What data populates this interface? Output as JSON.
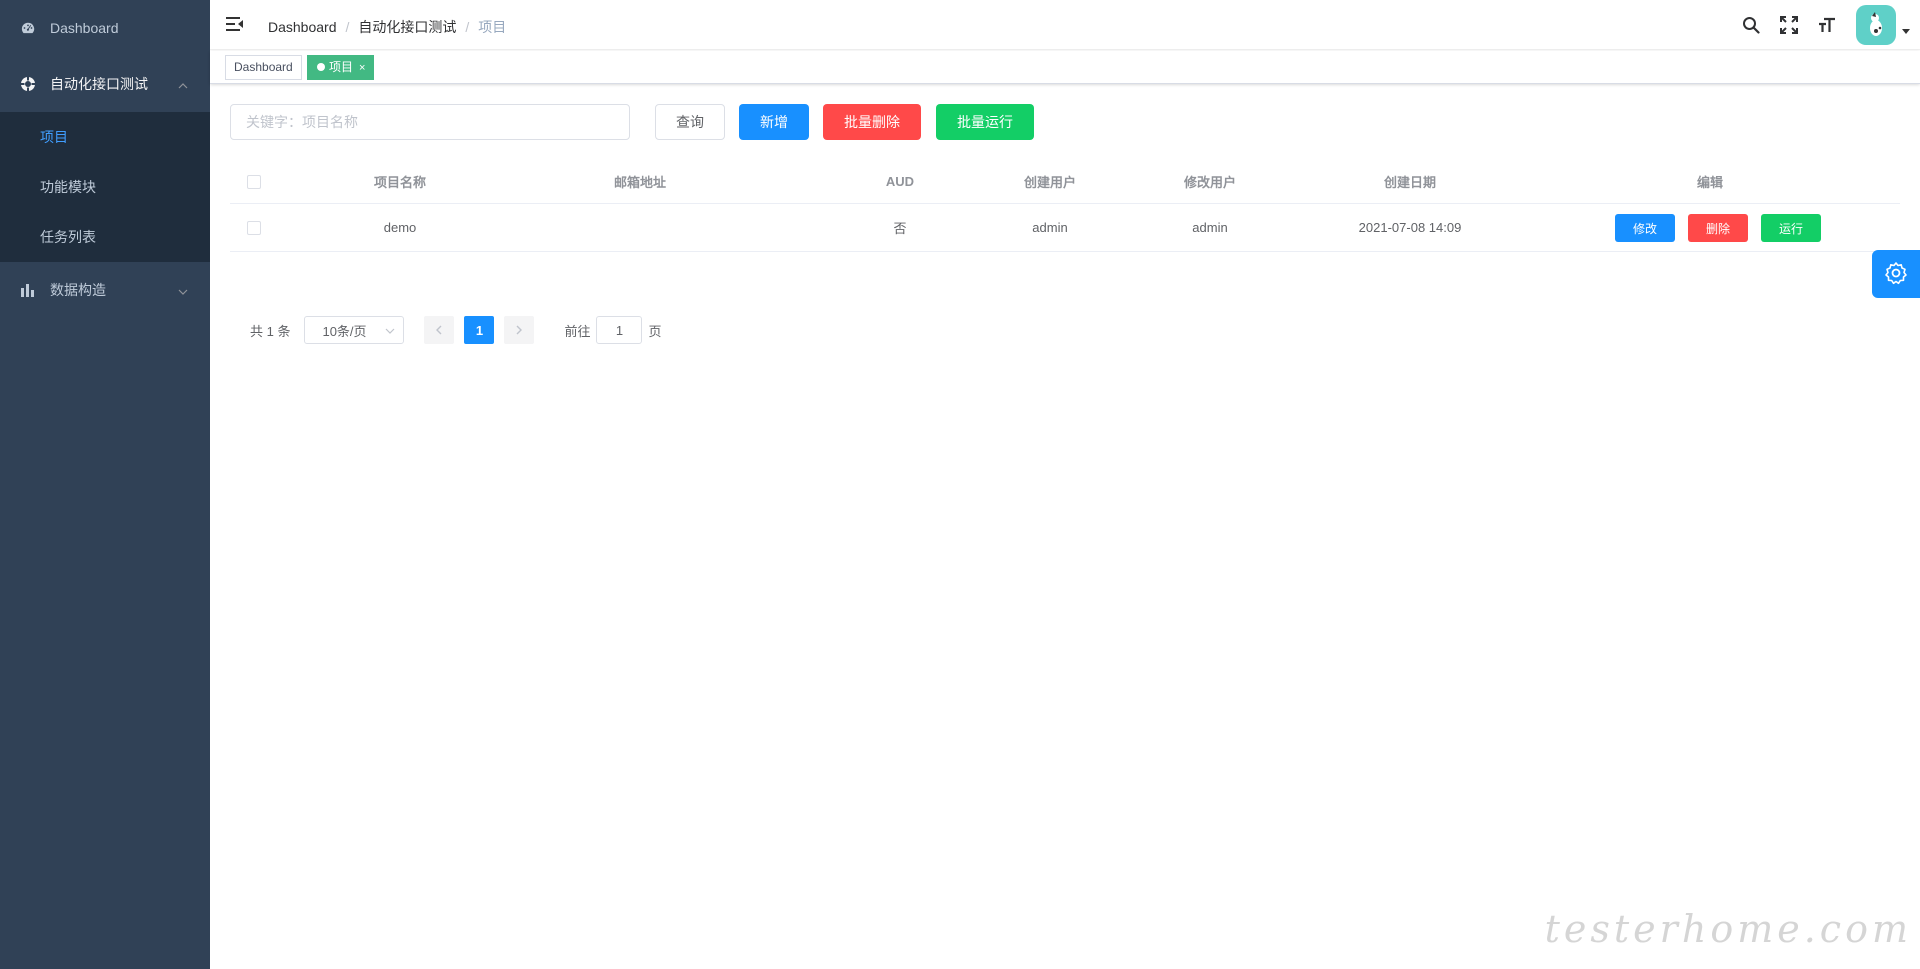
{
  "sidebar": {
    "items": [
      {
        "label": "Dashboard",
        "icon": "dashboard-icon"
      },
      {
        "label": "自动化接口测试",
        "icon": "circle-gear-icon",
        "expanded": true
      },
      {
        "label": "数据构造",
        "icon": "bar-chart-icon",
        "expanded": false
      }
    ],
    "submenu": [
      {
        "label": "项目",
        "active": true
      },
      {
        "label": "功能模块"
      },
      {
        "label": "任务列表"
      }
    ]
  },
  "navbar": {
    "breadcrumb": [
      "Dashboard",
      "自动化接口测试",
      "项目"
    ],
    "icons": [
      "search-icon",
      "fullscreen-icon",
      "font-size-icon"
    ]
  },
  "tags": {
    "items": [
      {
        "label": "Dashboard",
        "active": false
      },
      {
        "label": "项目",
        "active": true,
        "close": "×"
      }
    ]
  },
  "toolbar": {
    "search_placeholder": "关键字：项目名称",
    "query_label": "查询",
    "add_label": "新增",
    "batch_delete_label": "批量删除",
    "batch_run_label": "批量运行"
  },
  "table": {
    "columns": [
      "项目名称",
      "邮箱地址",
      "AUD",
      "创建用户",
      "修改用户",
      "创建日期",
      "编辑"
    ],
    "rows": [
      {
        "name": "demo",
        "email": "",
        "aud": "否",
        "creator": "admin",
        "modifier": "admin",
        "created": "2021-07-08 14:09"
      }
    ],
    "row_actions": {
      "edit": "修改",
      "delete": "删除",
      "run": "运行"
    }
  },
  "pagination": {
    "total_text": "共 1 条",
    "page_size": "10条/页",
    "current_page": "1",
    "goto_label": "前往",
    "goto_value": "1",
    "page_suffix": "页"
  },
  "watermark": "testerhome.com",
  "colors": {
    "sidebar_bg": "#304156",
    "submenu_bg": "#1f2d3d",
    "active_text": "#409eff",
    "primary": "#1890ff",
    "danger": "#ff4949",
    "success": "#13ce66",
    "tag_active": "#42b983"
  }
}
